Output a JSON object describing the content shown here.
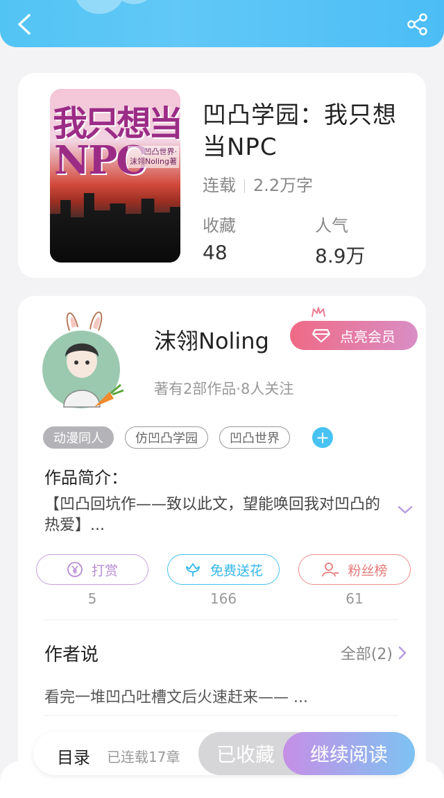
{
  "colors": {
    "header_gradient": "#52c4f4",
    "vip_gradient_start": "#ef6a86",
    "vip_gradient_end": "#d98ec4",
    "reward": "#b68bd6",
    "flower": "#35b7ea",
    "fans": "#e87b7b",
    "continue_start": "#c68fe6",
    "continue_end": "#7dc2f2"
  },
  "header": {
    "back_icon": "chevron-left-icon",
    "share_icon": "share-icon"
  },
  "book": {
    "cover_line1": "我只想当",
    "cover_line2": "NPC",
    "cover_sub": "凹凸世界·\n沫翎Noling著",
    "title": "凹凸学园：我只想当NPC",
    "status": "连载",
    "word_count": "2.2万字",
    "favorites_label": "收藏",
    "favorites_value": "48",
    "popularity_label": "人气",
    "popularity_value": "8.9万"
  },
  "author": {
    "name": "沫翎Noling",
    "vip_label": "点亮会员",
    "info": "著有2部作品·8人关注",
    "tags": [
      "动漫同人",
      "仿凹凸学园",
      "凹凸世界"
    ],
    "add_tag": "+"
  },
  "intro": {
    "title": "作品简介：",
    "text": "【凹凸回坑作——致以此文，望能唤回我对凹凸的热爱】..."
  },
  "actions": {
    "reward_label": "打赏",
    "reward_count": "5",
    "flower_label": "免费送花",
    "flower_count": "166",
    "fans_label": "粉丝榜",
    "fans_count": "61"
  },
  "author_say": {
    "title": "作者说",
    "all_label": "全部(2)",
    "text": "看完一堆凹凸吐槽文后火速赶来—— ..."
  },
  "bottom": {
    "catalog": "目录",
    "chapters": "已连载17章",
    "collected": "已收藏",
    "continue": "继续阅读"
  }
}
